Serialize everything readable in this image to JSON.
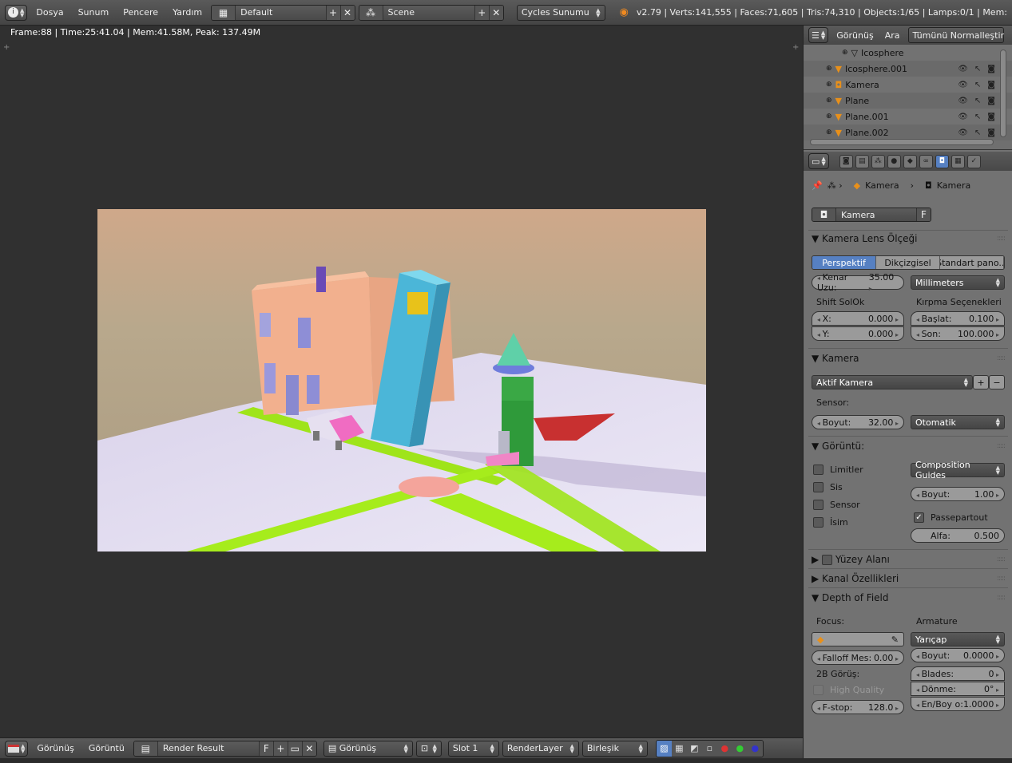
{
  "topbar": {
    "menus": [
      "Dosya",
      "Sunum",
      "Pencere",
      "Yardım"
    ],
    "layout": "Default",
    "scene": "Scene",
    "engine": "Cycles Sunumu",
    "stats": "v2.79 | Verts:141,555 | Faces:71,605 | Tris:74,310 | Objects:1/65 | Lamps:0/1 | Mem:"
  },
  "viewport": {
    "info": "Frame:88 | Time:25:41.04 | Mem:41.58M, Peak: 137.49M"
  },
  "bottombar": {
    "menus": [
      "Görünüş",
      "Görüntü"
    ],
    "image": "Render Result",
    "fake": "F",
    "view": "Görünüş",
    "slot": "Slot 1",
    "layer": "RenderLayer",
    "pass": "Birleşik"
  },
  "outliner": {
    "menus": [
      "Görünüş",
      "Ara"
    ],
    "display": "Tümünü Normalleştir",
    "items": [
      {
        "name": "Icosphere"
      },
      {
        "name": "Icosphere.001"
      },
      {
        "name": "Kamera"
      },
      {
        "name": "Plane"
      },
      {
        "name": "Plane.001"
      },
      {
        "name": "Plane.002"
      }
    ]
  },
  "props": {
    "breadcrumb": [
      "Kamera",
      "Kamera"
    ],
    "datablock": "Kamera",
    "fake": "F",
    "lens": {
      "title": "Kamera Lens Ölçeği",
      "tabs": [
        "Perspektif",
        "Dikçizgisel",
        "Standart pano..."
      ],
      "focal": "Kenar Uzu:",
      "focal_val": "35.00",
      "units": "Millimeters",
      "shift": "Shift SolOk",
      "x": "X:",
      "x_val": "0.000",
      "y": "Y:",
      "y_val": "0.000",
      "clip": "Kırpma Seçenekleri",
      "start": "Başlat:",
      "start_val": "0.100",
      "end": "Son:",
      "end_val": "100.000"
    },
    "camera": {
      "title": "Kamera",
      "preset": "Aktif Kamera",
      "sensor": "Sensor:",
      "size": "Boyut:",
      "size_val": "32.00",
      "fit": "Otomatik"
    },
    "display": {
      "title": "Görüntü:",
      "limits": "Limitler",
      "mist": "Sis",
      "sensor": "Sensor",
      "name": "İsim",
      "guides": "Composition Guides",
      "size": "Boyut:",
      "size_val": "1.00",
      "passepartout": "Passepartout",
      "alpha": "Alfa:",
      "alpha_val": "0.500"
    },
    "safe": "Yüzey Alanı",
    "stereo": "Kanal Özellikleri",
    "dof": {
      "title": "Depth of Field",
      "focus": "Focus:",
      "aperture": "Armature",
      "radius": "Yarıçap",
      "falloff": "Falloff Mes:",
      "falloff_val": "0.00",
      "size": "Boyut:",
      "size_val": "0.0000",
      "view2d": "2B Görüş:",
      "blades": "Blades:",
      "blades_val": "0",
      "hq": "High Quality",
      "rotation": "Dönme:",
      "rotation_val": "0°",
      "fstop": "F-stop:",
      "fstop_val": "128.0",
      "ratio": "En/Boy o:",
      "ratio_val": "1.0000"
    }
  }
}
